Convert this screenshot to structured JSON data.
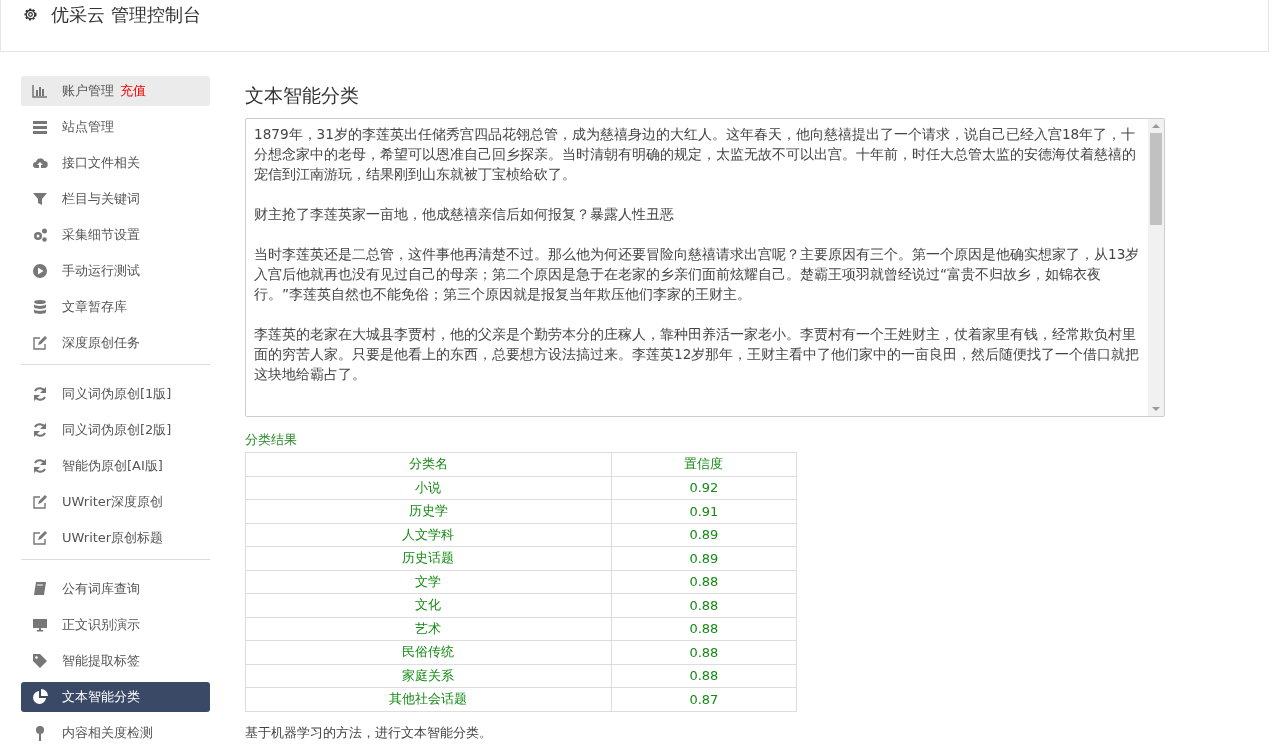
{
  "header": {
    "title": "优采云 管理控制台"
  },
  "sidebar": {
    "groups": [
      [
        {
          "label": "账户管理",
          "badge": "充值",
          "highlighted": true,
          "selected": false
        },
        {
          "label": "站点管理",
          "highlighted": false,
          "selected": false
        },
        {
          "label": "接口文件相关",
          "highlighted": false,
          "selected": false
        },
        {
          "label": "栏目与关键词",
          "highlighted": false,
          "selected": false
        },
        {
          "label": "采集细节设置",
          "highlighted": false,
          "selected": false
        },
        {
          "label": "手动运行测试",
          "highlighted": false,
          "selected": false
        },
        {
          "label": "文章暂存库",
          "highlighted": false,
          "selected": false
        },
        {
          "label": "深度原创任务",
          "highlighted": false,
          "selected": false
        }
      ],
      [
        {
          "label": "同义词伪原创[1版]",
          "highlighted": false,
          "selected": false
        },
        {
          "label": "同义词伪原创[2版]",
          "highlighted": false,
          "selected": false
        },
        {
          "label": "智能伪原创[AI版]",
          "highlighted": false,
          "selected": false
        },
        {
          "label": "UWriter深度原创",
          "highlighted": false,
          "selected": false
        },
        {
          "label": "UWriter原创标题",
          "highlighted": false,
          "selected": false
        }
      ],
      [
        {
          "label": "公有词库查询",
          "highlighted": false,
          "selected": false
        },
        {
          "label": "正文识别演示",
          "highlighted": false,
          "selected": false
        },
        {
          "label": "智能提取标签",
          "highlighted": false,
          "selected": false
        },
        {
          "label": "文本智能分类",
          "highlighted": false,
          "selected": true
        },
        {
          "label": "内容相关度检测",
          "highlighted": false,
          "selected": false
        }
      ]
    ]
  },
  "main": {
    "title": "文本智能分类",
    "input_text": [
      "1879年，31岁的李莲英出任储秀宫四品花翎总管，成为慈禧身边的大红人。这年春天，他向慈禧提出了一个请求，说自己已经入宫18年了，十分想念家中的老母，希望可以恩准自己回乡探亲。当时清朝有明确的规定，太监无故不可以出宫。十年前，时任大总管太监的安德海仗着慈禧的宠信到江南游玩，结果刚到山东就被丁宝桢给砍了。",
      "财主抢了李莲英家一亩地，他成慈禧亲信后如何报复？暴露人性丑恶",
      "当时李莲英还是二总管，这件事他再清楚不过。那么他为何还要冒险向慈禧请求出宫呢？主要原因有三个。第一个原因是他确实想家了，从13岁入宫后他就再也没有见过自己的母亲；第二个原因是急于在老家的乡亲们面前炫耀自己。楚霸王项羽就曾经说过“富贵不归故乡，如锦衣夜行。”李莲英自然也不能免俗；第三个原因就是报复当年欺压他们李家的王财主。",
      "李莲英的老家在大城县李贾村，他的父亲是个勤劳本分的庄稼人，靠种田养活一家老小。李贾村有一个王姓财主，仗着家里有钱，经常欺负村里面的穷苦人家。只要是他看上的东西，总要想方设法搞过来。李莲英12岁那年，王财主看中了他们家中的一亩良田，然后随便找了一个借口就把这块地给霸占了。"
    ],
    "result_title": "分类结果",
    "table": {
      "columns": [
        "分类名",
        "置信度"
      ],
      "rows": [
        [
          "小说",
          "0.92"
        ],
        [
          "历史学",
          "0.91"
        ],
        [
          "人文学科",
          "0.89"
        ],
        [
          "历史话题",
          "0.89"
        ],
        [
          "文学",
          "0.88"
        ],
        [
          "文化",
          "0.88"
        ],
        [
          "艺术",
          "0.88"
        ],
        [
          "民俗传统",
          "0.88"
        ],
        [
          "家庭关系",
          "0.88"
        ],
        [
          "其他社会话题",
          "0.87"
        ]
      ]
    },
    "note": "基于机器学习的方法，进行文本智能分类。"
  }
}
